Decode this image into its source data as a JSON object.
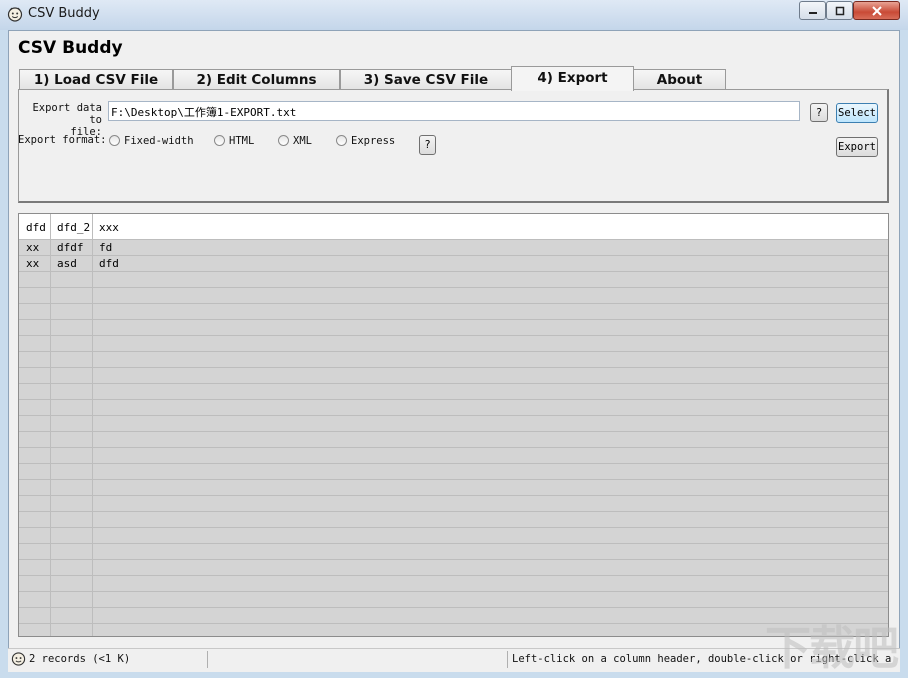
{
  "window": {
    "title": "CSV Buddy"
  },
  "app": {
    "heading": "CSV Buddy"
  },
  "tabs": [
    {
      "label": "1) Load CSV File",
      "active": false
    },
    {
      "label": "2) Edit Columns",
      "active": false
    },
    {
      "label": "3) Save CSV File",
      "active": false
    },
    {
      "label": "4) Export",
      "active": true
    },
    {
      "label": "About",
      "active": false
    }
  ],
  "export": {
    "file_label_line1": "Export data to",
    "file_label_line2": "file:",
    "file_path": "F:\\Desktop\\工作簿1-EXPORT.txt",
    "help_label": "?",
    "select_label": "Select",
    "format_label": "Export format:",
    "formats": [
      "Fixed-width",
      "HTML",
      "XML",
      "Express"
    ],
    "export_label": "Export"
  },
  "table": {
    "columns": [
      "dfd",
      "dfd_2",
      "xxx"
    ],
    "rows": [
      [
        "xx",
        "dfdf",
        "fd"
      ],
      [
        "xx",
        "asd",
        "dfd"
      ]
    ]
  },
  "status": {
    "records": "2 records (<1 K)",
    "hint": "Left-click on a column header, double-click or right-click a li"
  },
  "watermark": "下载吧",
  "colors": {
    "titlebar": "#c9dced",
    "grid_bg": "#d4d4d4",
    "button_focus": "#bee6fd"
  }
}
